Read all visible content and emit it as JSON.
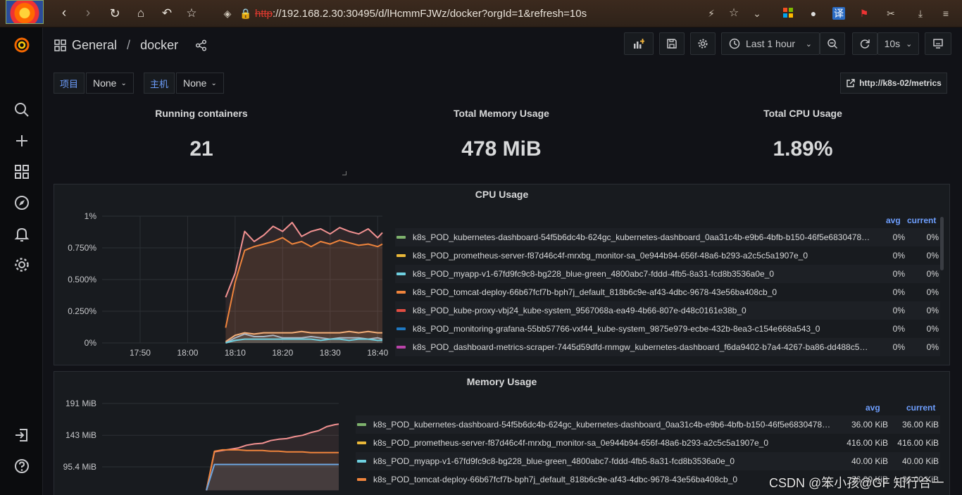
{
  "browser": {
    "url_protocol": "http",
    "url_rest": "://192.168.2.30:30495/d/lHcmmFJWz/docker?orgId=1&refresh=10s",
    "translate_label": "译"
  },
  "breadcrumb": {
    "folder": "General",
    "separator": "/",
    "dashboard": "docker"
  },
  "toolbar": {
    "time_range": "Last 1 hour",
    "refresh_interval": "10s"
  },
  "variables": [
    {
      "label": "项目",
      "value": "None"
    },
    {
      "label": "主机",
      "value": "None"
    }
  ],
  "link": {
    "label": "http://k8s-02/metrics"
  },
  "stats": [
    {
      "title": "Running containers",
      "value": "21"
    },
    {
      "title": "Total Memory Usage",
      "value": "478 MiB"
    },
    {
      "title": "Total CPU Usage",
      "value": "1.89%"
    }
  ],
  "colors": {
    "green": "#7eb26d",
    "yellow": "#eab839",
    "cyan": "#6ed0e0",
    "orange": "#ef843c",
    "red": "#e24d42",
    "blue": "#1f78c1",
    "purple": "#ba43a9",
    "salmon": "#f29191"
  },
  "cpu_panel": {
    "title": "CPU Usage",
    "legend_headers": {
      "avg": "avg",
      "current": "current"
    },
    "rows": [
      {
        "name": "k8s_POD_kubernetes-dashboard-54f5b6dc4b-624gc_kubernetes-dashboard_0aa31c4b-e9b6-4bfb-b150-46f5e6830478_0",
        "avg": "0%",
        "current": "0%",
        "color": "#7eb26d"
      },
      {
        "name": "k8s_POD_prometheus-server-f87d46c4f-mrxbg_monitor-sa_0e944b94-656f-48a6-b293-a2c5c5a1907e_0",
        "avg": "0%",
        "current": "0%",
        "color": "#eab839"
      },
      {
        "name": "k8s_POD_myapp-v1-67fd9fc9c8-bg228_blue-green_4800abc7-fddd-4fb5-8a31-fcd8b3536a0e_0",
        "avg": "0%",
        "current": "0%",
        "color": "#6ed0e0"
      },
      {
        "name": "k8s_POD_tomcat-deploy-66b67fcf7b-bph7j_default_818b6c9e-af43-4dbc-9678-43e56ba408cb_0",
        "avg": "0%",
        "current": "0%",
        "color": "#ef843c"
      },
      {
        "name": "k8s_POD_kube-proxy-vbj24_kube-system_9567068a-ea49-4b66-807e-d48c0161e38b_0",
        "avg": "0%",
        "current": "0%",
        "color": "#e24d42"
      },
      {
        "name": "k8s_POD_monitoring-grafana-55bb57766-vxf44_kube-system_9875e979-ecbe-432b-8ea3-c154e668a543_0",
        "avg": "0%",
        "current": "0%",
        "color": "#1f78c1"
      },
      {
        "name": "k8s_POD_dashboard-metrics-scraper-7445d59dfd-rnmgw_kubernetes-dashboard_f6da9402-b7a4-4267-ba86-dd488c52...",
        "avg": "0%",
        "current": "0%",
        "color": "#ba43a9"
      }
    ]
  },
  "memory_panel": {
    "title": "Memory Usage",
    "legend_headers": {
      "avg": "avg",
      "current": "current"
    },
    "rows": [
      {
        "name": "k8s_POD_kubernetes-dashboard-54f5b6dc4b-624gc_kubernetes-dashboard_0aa31c4b-e9b6-4bfb-b150-46f5e6830478_0",
        "avg": "36.00 KiB",
        "current": "36.00 KiB",
        "color": "#7eb26d"
      },
      {
        "name": "k8s_POD_prometheus-server-f87d46c4f-mrxbg_monitor-sa_0e944b94-656f-48a6-b293-a2c5c5a1907e_0",
        "avg": "416.00 KiB",
        "current": "416.00 KiB",
        "color": "#eab839"
      },
      {
        "name": "k8s_POD_myapp-v1-67fd9fc9c8-bg228_blue-green_4800abc7-fddd-4fb5-8a31-fcd8b3536a0e_0",
        "avg": "40.00 KiB",
        "current": "40.00 KiB",
        "color": "#6ed0e0"
      },
      {
        "name": "k8s_POD_tomcat-deploy-66b67fcf7b-bph7j_default_818b6c9e-af43-4dbc-9678-43e56ba408cb_0",
        "avg": "36.00 KiB",
        "current": "36.00 KiB",
        "color": "#ef843c"
      }
    ]
  },
  "watermark": "CSDN @笨小孩@GF 知行合一",
  "chart_data": [
    {
      "type": "area",
      "title": "CPU Usage",
      "x_ticks": [
        "17:50",
        "18:00",
        "18:10",
        "18:20",
        "18:30",
        "18:40"
      ],
      "y_ticks": [
        "0%",
        "0.250%",
        "0.500%",
        "0.750%",
        "1%"
      ],
      "ylim": [
        0,
        1
      ],
      "x": [
        "18:08",
        "18:10",
        "18:12",
        "18:14",
        "18:16",
        "18:18",
        "18:20",
        "18:22",
        "18:24",
        "18:26",
        "18:28",
        "18:30",
        "18:32",
        "18:34",
        "18:36",
        "18:38",
        "18:40",
        "18:41"
      ],
      "series": [
        {
          "name": "salmon",
          "color": "#f29191",
          "values": [
            0.36,
            0.55,
            0.88,
            0.8,
            0.85,
            0.92,
            0.88,
            0.95,
            0.84,
            0.88,
            0.9,
            0.86,
            0.91,
            0.88,
            0.86,
            0.9,
            0.83,
            0.87
          ]
        },
        {
          "name": "orange",
          "color": "#ef843c",
          "values": [
            0.12,
            0.48,
            0.73,
            0.76,
            0.78,
            0.8,
            0.83,
            0.78,
            0.8,
            0.76,
            0.8,
            0.78,
            0.81,
            0.79,
            0.77,
            0.78,
            0.76,
            0.78
          ]
        },
        {
          "name": "light-orange",
          "color": "#f4b07a",
          "values": [
            0.01,
            0.06,
            0.08,
            0.07,
            0.08,
            0.08,
            0.08,
            0.08,
            0.09,
            0.08,
            0.08,
            0.08,
            0.08,
            0.09,
            0.08,
            0.09,
            0.08,
            0.08
          ]
        },
        {
          "name": "gray",
          "color": "#aab3bf",
          "values": [
            0.0,
            0.04,
            0.07,
            0.05,
            0.05,
            0.06,
            0.04,
            0.04,
            0.04,
            0.05,
            0.04,
            0.03,
            0.04,
            0.04,
            0.04,
            0.03,
            0.04,
            0.03
          ]
        },
        {
          "name": "cyan",
          "color": "#6ed0e0",
          "values": [
            0.0,
            0.02,
            0.03,
            0.03,
            0.03,
            0.03,
            0.03,
            0.03,
            0.03,
            0.03,
            0.02,
            0.03,
            0.03,
            0.02,
            0.03,
            0.03,
            0.02,
            0.02
          ]
        }
      ]
    },
    {
      "type": "area",
      "title": "Memory Usage",
      "y_ticks": [
        "95.4 MiB",
        "143 MiB",
        "191 MiB"
      ],
      "ylim": [
        60,
        191
      ],
      "x": [
        "18:08",
        "18:10",
        "18:12",
        "18:14",
        "18:16",
        "18:18",
        "18:20",
        "18:22",
        "18:24",
        "18:26",
        "18:28",
        "18:30",
        "18:32",
        "18:34",
        "18:36",
        "18:38",
        "18:40",
        "18:41"
      ],
      "series": [
        {
          "name": "salmon",
          "color": "#f29191",
          "values": [
            60,
            118,
            120,
            122,
            124,
            128,
            130,
            131,
            135,
            137,
            138,
            141,
            143,
            147,
            150,
            156,
            159,
            160
          ]
        },
        {
          "name": "orange",
          "color": "#ef843c",
          "values": [
            60,
            119,
            121,
            121,
            121,
            120,
            120,
            120,
            119,
            119,
            118,
            118,
            118,
            117,
            117,
            117,
            117,
            117
          ]
        },
        {
          "name": "blue",
          "color": "#6ea6e0",
          "values": [
            60,
            99,
            99,
            99,
            99,
            99,
            99,
            99,
            99,
            99,
            99,
            99,
            99,
            99,
            99,
            99,
            99,
            99
          ]
        }
      ]
    }
  ]
}
